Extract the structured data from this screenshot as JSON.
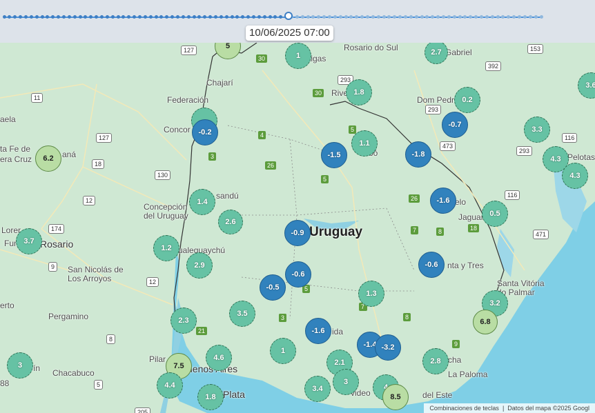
{
  "timeline": {
    "timestamp": "10/06/2025 07:00",
    "progress": 0.53,
    "active_color": "#3e7fc4",
    "inactive_color": "#8fb8de"
  },
  "map": {
    "labels": [
      {
        "text": "Rosario do Sul",
        "cls": ""
      },
      {
        "text": "Gabriel",
        "cls": ""
      },
      {
        "text": "Federación",
        "cls": ""
      },
      {
        "text": "Chajarí",
        "cls": ""
      },
      {
        "text": "Concor",
        "cls": ""
      },
      {
        "text": "Dom Pedri",
        "cls": ""
      },
      {
        "text": "Pelotas",
        "cls": ""
      },
      {
        "text": "aela",
        "cls": ""
      },
      {
        "text": "ta Fe de",
        "cls": ""
      },
      {
        "text": "era Cruz",
        "cls": ""
      },
      {
        "text": "aná",
        "cls": ""
      },
      {
        "text": "bó",
        "cls": ""
      },
      {
        "text": "Concepción",
        "cls": ""
      },
      {
        "text": "del Uruguay",
        "cls": ""
      },
      {
        "text": "sandú",
        "cls": ""
      },
      {
        "text": "Lorer",
        "cls": ""
      },
      {
        "text": "Fun",
        "cls": ""
      },
      {
        "text": "Rosario",
        "cls": "med"
      },
      {
        "text": "ualeguaychú",
        "cls": ""
      },
      {
        "text": "Uruguay",
        "cls": "big"
      },
      {
        "text": "elo",
        "cls": ""
      },
      {
        "text": "Jaguar",
        "cls": ""
      },
      {
        "text": "San Nicolás de",
        "cls": ""
      },
      {
        "text": "Los Arroyos",
        "cls": ""
      },
      {
        "text": "nta y Tres",
        "cls": ""
      },
      {
        "text": "Santa Vitória",
        "cls": ""
      },
      {
        "text": "do Palmar",
        "cls": ""
      },
      {
        "text": "erto",
        "cls": ""
      },
      {
        "text": "Pergamino",
        "cls": ""
      },
      {
        "text": "ida",
        "cls": ""
      },
      {
        "text": "Pilar",
        "cls": ""
      },
      {
        "text": "uenos Aires",
        "cls": "med"
      },
      {
        "text": "ín",
        "cls": ""
      },
      {
        "text": "Chacabuco",
        "cls": ""
      },
      {
        "text": "La Paloma",
        "cls": ""
      },
      {
        "text": "cha",
        "cls": ""
      },
      {
        "text": "Plata",
        "cls": "med"
      },
      {
        "text": "del Este",
        "cls": ""
      },
      {
        "text": "tigas",
        "cls": ""
      },
      {
        "text": "Rive",
        "cls": ""
      },
      {
        "text": "video",
        "cls": ""
      },
      {
        "text": "88",
        "cls": ""
      }
    ],
    "road_shields": [
      "127",
      "153",
      "392",
      "293",
      "293",
      "473",
      "116",
      "293",
      "11",
      "127",
      "18",
      "130",
      "12",
      "174",
      "9",
      "12",
      "8",
      "5",
      "205",
      "116",
      "471"
    ],
    "route_shields": [
      "30",
      "30",
      "5",
      "4",
      "3",
      "26",
      "5",
      "26",
      "7",
      "8",
      "18",
      "7",
      "5",
      "3",
      "8",
      "7",
      "9",
      "21",
      "3"
    ],
    "markers": [
      {
        "value": "5",
        "color": "#b9dda4"
      },
      {
        "value": "1",
        "color": "#66c2a4"
      },
      {
        "value": "2.7",
        "color": "#66c2a4"
      },
      {
        "value": "3.6",
        "color": "#66c2a4"
      },
      {
        "value": "1.8",
        "color": "#66c2a4"
      },
      {
        "value": "0.2",
        "color": "#66c2a4"
      },
      {
        "value": "",
        "color": "#66c2a4"
      },
      {
        "value": "-0.2",
        "color": "#3182bd"
      },
      {
        "value": "-0.7",
        "color": "#3182bd"
      },
      {
        "value": "3.3",
        "color": "#66c2a4"
      },
      {
        "value": "6.2",
        "color": "#b9dda4"
      },
      {
        "value": "1.1",
        "color": "#66c2a4"
      },
      {
        "value": "-1.5",
        "color": "#3182bd"
      },
      {
        "value": "-1.8",
        "color": "#3182bd"
      },
      {
        "value": "4.3",
        "color": "#66c2a4"
      },
      {
        "value": "4.3",
        "color": "#66c2a4"
      },
      {
        "value": "-1.6",
        "color": "#3182bd"
      },
      {
        "value": "1.4",
        "color": "#66c2a4"
      },
      {
        "value": "2.6",
        "color": "#66c2a4"
      },
      {
        "value": "0.5",
        "color": "#66c2a4"
      },
      {
        "value": "-0.9",
        "color": "#3182bd"
      },
      {
        "value": "3.7",
        "color": "#66c2a4"
      },
      {
        "value": "1.2",
        "color": "#66c2a4"
      },
      {
        "value": "-0.6",
        "color": "#3182bd"
      },
      {
        "value": "2.9",
        "color": "#66c2a4"
      },
      {
        "value": "-0.6",
        "color": "#3182bd"
      },
      {
        "value": "-0.5",
        "color": "#3182bd"
      },
      {
        "value": "1.3",
        "color": "#66c2a4"
      },
      {
        "value": "3.2",
        "color": "#66c2a4"
      },
      {
        "value": "3.5",
        "color": "#66c2a4"
      },
      {
        "value": "2.3",
        "color": "#66c2a4"
      },
      {
        "value": "6.8",
        "color": "#b9dda4"
      },
      {
        "value": "-1.6",
        "color": "#3182bd"
      },
      {
        "value": "1",
        "color": "#66c2a4"
      },
      {
        "value": "-1.4",
        "color": "#3182bd"
      },
      {
        "value": "-3.2",
        "color": "#3182bd"
      },
      {
        "value": "4.6",
        "color": "#66c2a4"
      },
      {
        "value": "7.5",
        "color": "#b9dda4"
      },
      {
        "value": "2.1",
        "color": "#66c2a4"
      },
      {
        "value": "2.8",
        "color": "#66c2a4"
      },
      {
        "value": "3",
        "color": "#66c2a4"
      },
      {
        "value": "4.4",
        "color": "#66c2a4"
      },
      {
        "value": "3",
        "color": "#66c2a4"
      },
      {
        "value": "3.4",
        "color": "#66c2a4"
      },
      {
        "value": "1.8",
        "color": "#66c2a4"
      },
      {
        "value": "4",
        "color": "#66c2a4"
      },
      {
        "value": "8.5",
        "color": "#b9dda4"
      }
    ],
    "colors": {
      "land": "#cfe8d3",
      "water": "#7fcfe6",
      "border": "#333333"
    }
  },
  "attribution": {
    "keyboard": "Combinaciones de teclas",
    "data": "Datos del mapa ©2025 Googl"
  }
}
